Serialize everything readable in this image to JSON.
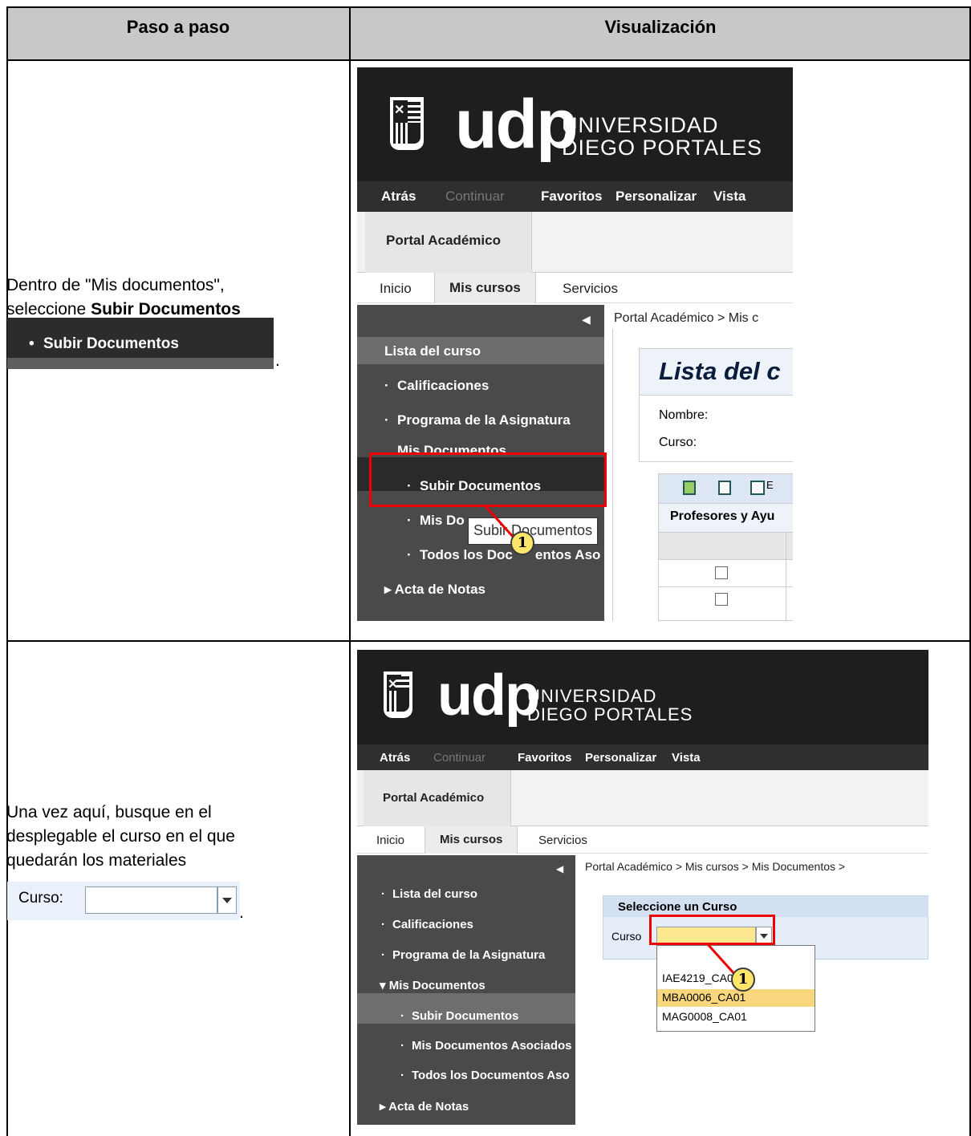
{
  "headers": {
    "left": "Paso a paso",
    "right": "Visualización"
  },
  "step1": {
    "text_line1": "Dentro de \"Mis documentos\",",
    "text_prefix": "seleccione ",
    "text_bold": "Subir Documentos",
    "sample_label": "Subir Documentos",
    "trailing": "."
  },
  "step2": {
    "text_line1": "Una vez aquí, busque en el",
    "text_line2": "desplegable el curso en el que",
    "text_line3": "quedarán los materiales",
    "sample_label": "Curso:",
    "trailing": "."
  },
  "portal": {
    "logo_text": "udp",
    "logo_line1": "UNIVERSIDAD",
    "logo_line2": "DIEGO PORTALES",
    "nav": {
      "back": "Atrás",
      "forward": "Continuar",
      "favorites": "Favoritos",
      "personalize": "Personalizar",
      "view": "Vista"
    },
    "portal_tab": "Portal Académico",
    "tabs": [
      "Inicio",
      "Mis cursos",
      "Servicios"
    ],
    "collapse_glyph": "◀",
    "menu": {
      "lista": "Lista del curso",
      "calificaciones": "Calificaciones",
      "programa": "Programa de la Asignatura",
      "mis_documentos": "Mis Documentos",
      "subir": "Subir Documentos",
      "mis_doc_asociados": "Mis Documentos Asociados",
      "mis_doc_short": "Mis Do",
      "todos": "Todos los Documentos Aso",
      "todos_short": "Todos los Doc",
      "todos_short_tail": "entos Aso",
      "acta": "Acta de Notas"
    }
  },
  "shot1": {
    "breadcrumb": "Portal Académico  >  Mis c",
    "content_title": "Lista del c",
    "field_nombre": "Nombre:",
    "field_curso": "Curso:",
    "toolbar_tail": "E",
    "table_header": "Profesores y Ayu",
    "tooltip": "Subir Documentos",
    "marker": "1"
  },
  "shot2": {
    "breadcrumb": "Portal Académico  >  Mis cursos  >  Mis Documentos  >",
    "panel_title": "Seleccione un Curso",
    "field_label": "Curso",
    "options": [
      "IAE4219_CA01",
      "MBA0006_CA01",
      "MAG0008_CA01"
    ],
    "marker": "1"
  },
  "colors": {
    "highlight": "#e00000",
    "marker_fill": "#ffe56a",
    "selected_option": "#f9d77e"
  }
}
